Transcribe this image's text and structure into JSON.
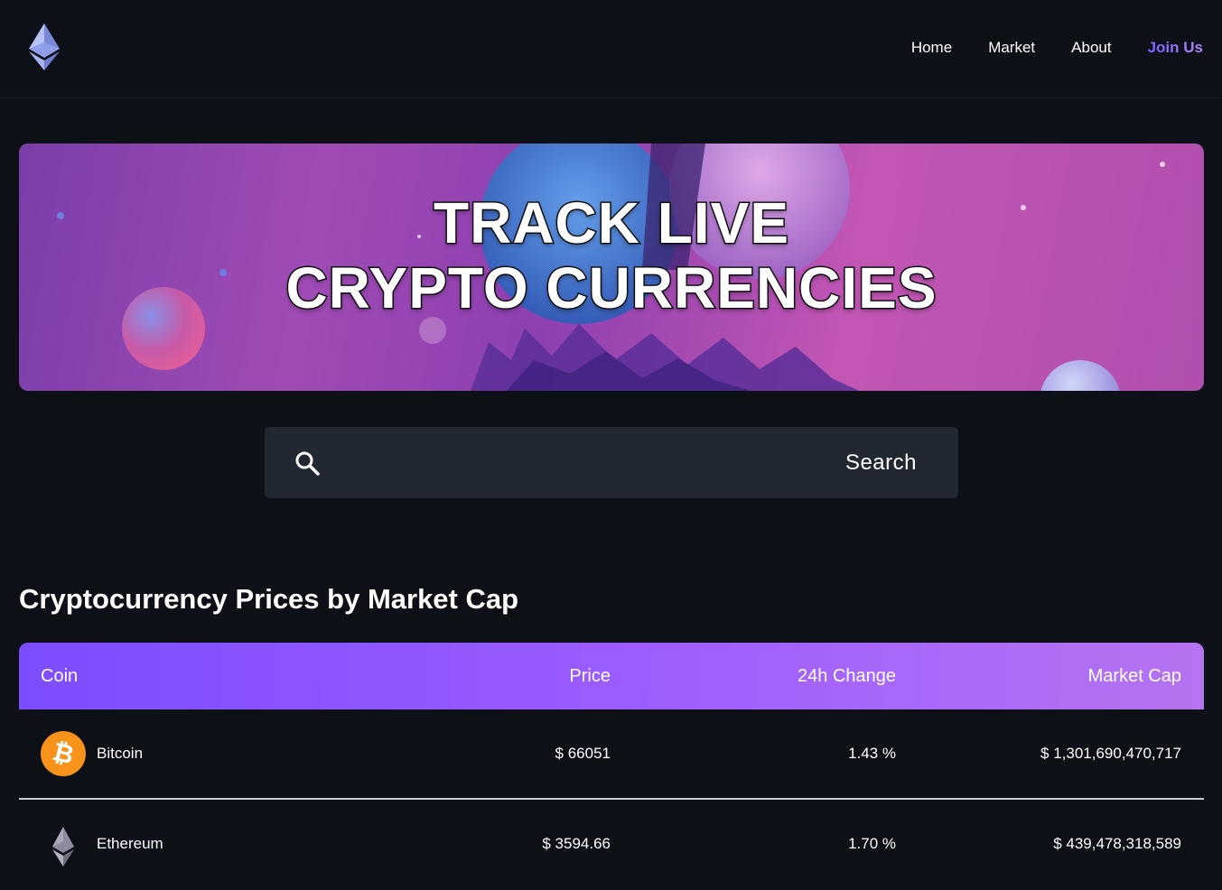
{
  "nav": {
    "logo_icon": "ethereum-logo-icon",
    "links": [
      {
        "label": "Home"
      },
      {
        "label": "Market"
      },
      {
        "label": "About"
      },
      {
        "label": "Join Us"
      }
    ]
  },
  "hero": {
    "line1": "TRACK LIVE",
    "line2": "CRYPTO CURRENCIES"
  },
  "search": {
    "icon": "search-icon",
    "placeholder": "",
    "value": "",
    "button_label": "Search"
  },
  "section_title": "Cryptocurrency Prices by Market Cap",
  "table": {
    "headers": {
      "coin": "Coin",
      "price": "Price",
      "change": "24h Change",
      "market_cap": "Market Cap"
    },
    "rows": [
      {
        "icon": "bitcoin-icon",
        "name": "Bitcoin",
        "price": "$ 66051",
        "change": "1.43 %",
        "market_cap": "$ 1,301,690,470,717"
      },
      {
        "icon": "ethereum-icon",
        "name": "Ethereum",
        "price": "$ 3594.66",
        "change": "1.70 %",
        "market_cap": "$ 439,478,318,589"
      }
    ]
  },
  "colors": {
    "background": "#0d1017",
    "accent_gradient_start": "#7c4dff",
    "accent_gradient_end": "#b573f0",
    "search_bg": "#222831",
    "bitcoin_orange": "#f7931a"
  }
}
